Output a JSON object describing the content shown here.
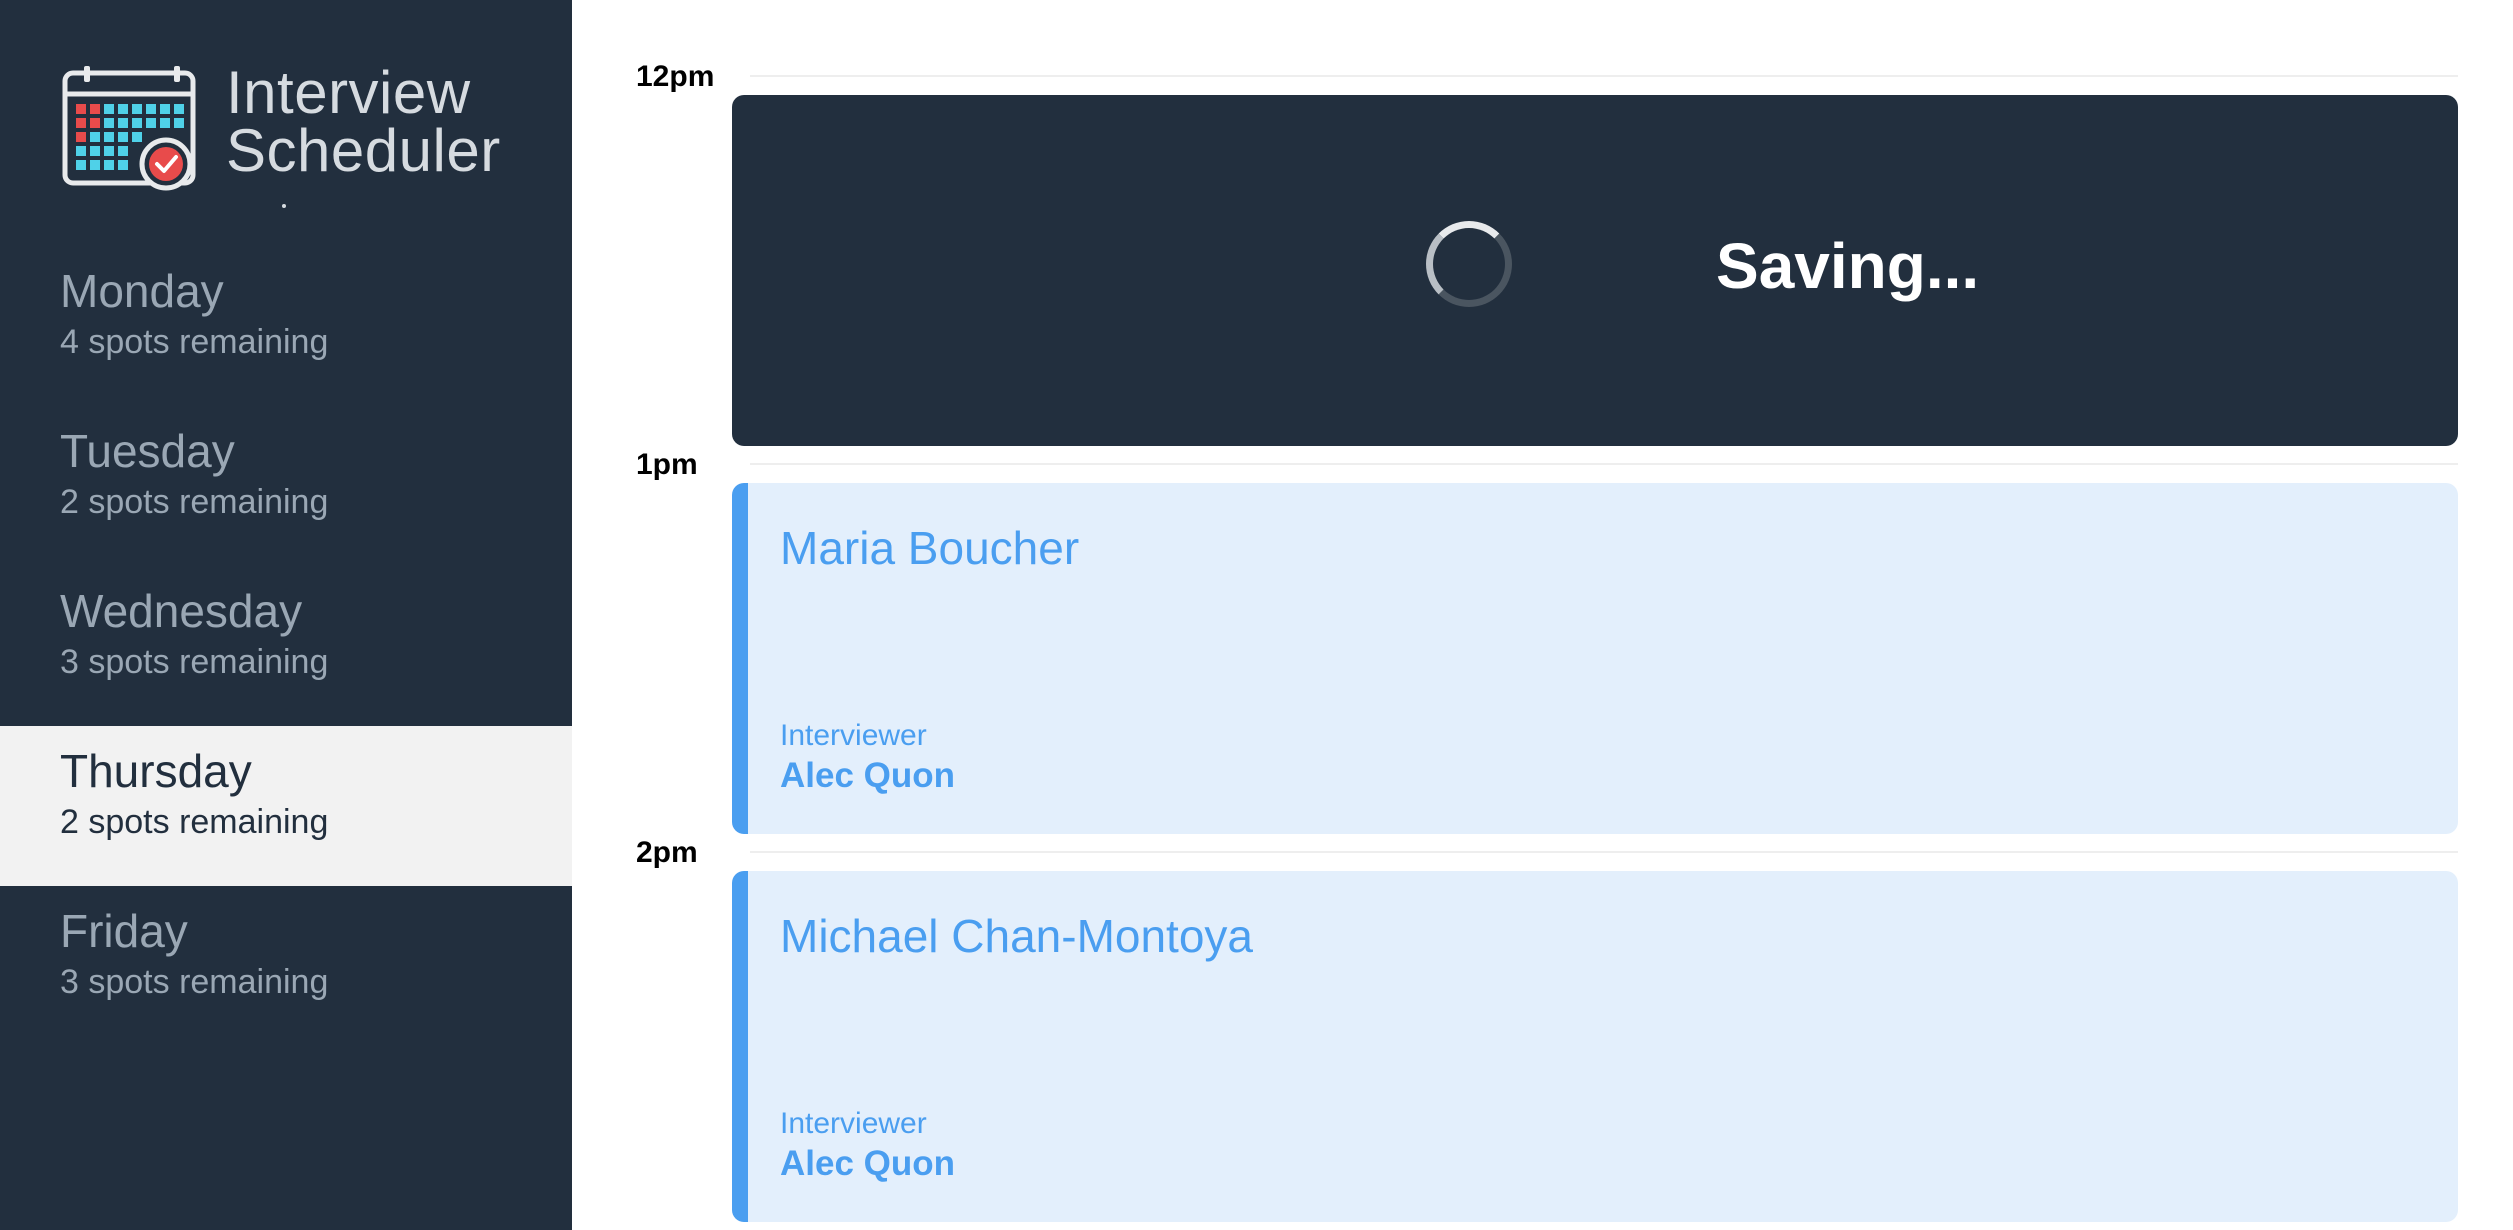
{
  "brand": {
    "line1": "Interview",
    "line2": "Scheduler",
    "logo_icon": "calendar-check-icon"
  },
  "days": [
    {
      "name": "Monday",
      "spots": "4 spots remaining",
      "selected": false
    },
    {
      "name": "Tuesday",
      "spots": "2 spots remaining",
      "selected": false
    },
    {
      "name": "Wednesday",
      "spots": "3 spots remaining",
      "selected": false
    },
    {
      "name": "Thursday",
      "spots": "2 spots remaining",
      "selected": true
    },
    {
      "name": "Friday",
      "spots": "3 spots remaining",
      "selected": false
    }
  ],
  "schedule": {
    "times": [
      "12pm",
      "1pm",
      "2pm"
    ],
    "saving": {
      "text": "Saving..."
    },
    "appointments": [
      {
        "student": "Maria Boucher",
        "interviewer_label": "Interviewer",
        "interviewer": "Alec Quon"
      },
      {
        "student": "Michael Chan-Montoya",
        "interviewer_label": "Interviewer",
        "interviewer": "Alec Quon"
      }
    ]
  },
  "colors": {
    "sidebar_bg": "#222f3e",
    "selected_bg": "#f2f2f2",
    "accent_blue": "#4a9ef0",
    "card_bg": "#e3effc",
    "icon_red": "#e84b4b",
    "icon_cyan": "#4fd1e8"
  }
}
